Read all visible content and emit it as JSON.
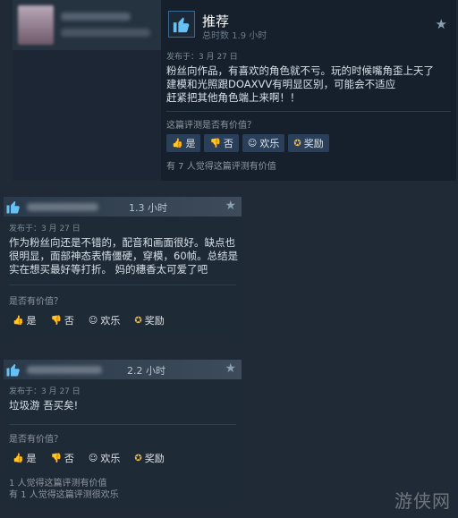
{
  "review1": {
    "verdict": "推荐",
    "hours": "总时数 1.9 小时",
    "posted": "发布于：3 月 27 日",
    "lines": [
      "粉丝向作品，有喜欢的角色就不亏。玩的时候嘴角歪上天了",
      "建模和光照跟DOAXVV有明显区别，可能会不适应",
      "赶紧把其他角色端上来啊！！"
    ],
    "helpful_q": "这篇评测是否有价值？",
    "votes": {
      "yes": "是",
      "no": "否",
      "funny": "欢乐",
      "award": "奖励"
    },
    "found": "有 7 人觉得这篇评测有价值"
  },
  "review2": {
    "hours": "1.3 小时",
    "posted": "发布于：3 月 27 日",
    "lines": [
      "作为粉丝向还是不错的，配音和画面很好。缺点也",
      "很明显，面部神态表情僵硬，穿模，60帧。总结是",
      "实在想买最好等打折。 妈的穗香太可爱了吧"
    ],
    "helpful_q": "是否有价值？",
    "votes": {
      "yes": "是",
      "no": "否",
      "funny": "欢乐",
      "award": "奖励"
    }
  },
  "review3": {
    "hours": "2.2 小时",
    "posted": "发布于：3 月 27 日",
    "lines": [
      "垃圾游 吾买矣!"
    ],
    "helpful_q": "是否有价值？",
    "votes": {
      "yes": "是",
      "no": "否",
      "funny": "欢乐",
      "award": "奖励"
    },
    "found1": "1 人觉得这篇评测有价值",
    "found2": "有 1 人觉得这篇评测很欢乐"
  },
  "watermark": "游侠网",
  "icons": {
    "thumb": "thumbs-up-icon",
    "thumb_down": "thumbs-down-icon",
    "star": "star-icon",
    "funny": "smiley-icon",
    "award": "award-icon"
  }
}
